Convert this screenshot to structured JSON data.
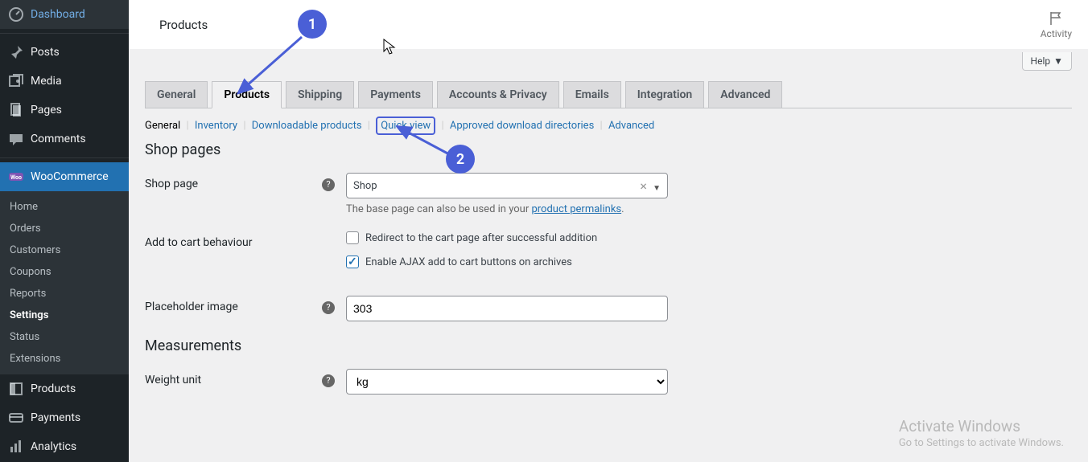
{
  "sidebar": {
    "dashboard": "Dashboard",
    "posts": "Posts",
    "media": "Media",
    "pages": "Pages",
    "comments": "Comments",
    "woocommerce": "WooCommerce",
    "woo_sub": [
      "Home",
      "Orders",
      "Customers",
      "Coupons",
      "Reports",
      "Settings",
      "Status",
      "Extensions"
    ],
    "woo_active_index": 5,
    "products": "Products",
    "payments": "Payments",
    "analytics": "Analytics"
  },
  "topbar": {
    "title": "Products",
    "activity": "Activity",
    "help": "Help"
  },
  "tabs": [
    "General",
    "Products",
    "Shipping",
    "Payments",
    "Accounts & Privacy",
    "Emails",
    "Integration",
    "Advanced"
  ],
  "tabs_active_index": 1,
  "subnav": [
    "General",
    "Inventory",
    "Downloadable products",
    "Quick view",
    "Approved download directories",
    "Advanced"
  ],
  "subnav_current_index": 0,
  "subnav_highlight_index": 3,
  "sections": {
    "shop_pages": "Shop pages",
    "measurements": "Measurements"
  },
  "fields": {
    "shop_page": {
      "label": "Shop page",
      "value": "Shop",
      "desc_prefix": "The base page can also be used in your ",
      "desc_link": "product permalinks"
    },
    "add_to_cart": {
      "label": "Add to cart behaviour",
      "opt1": "Redirect to the cart page after successful addition",
      "opt2": "Enable AJAX add to cart buttons on archives",
      "opt1_checked": false,
      "opt2_checked": true
    },
    "placeholder": {
      "label": "Placeholder image",
      "value": "303"
    },
    "weight_unit": {
      "label": "Weight unit",
      "value": "kg"
    }
  },
  "annotations": {
    "n1": "1",
    "n2": "2"
  },
  "watermark": {
    "title": "Activate Windows",
    "sub": "Go to Settings to activate Windows."
  }
}
